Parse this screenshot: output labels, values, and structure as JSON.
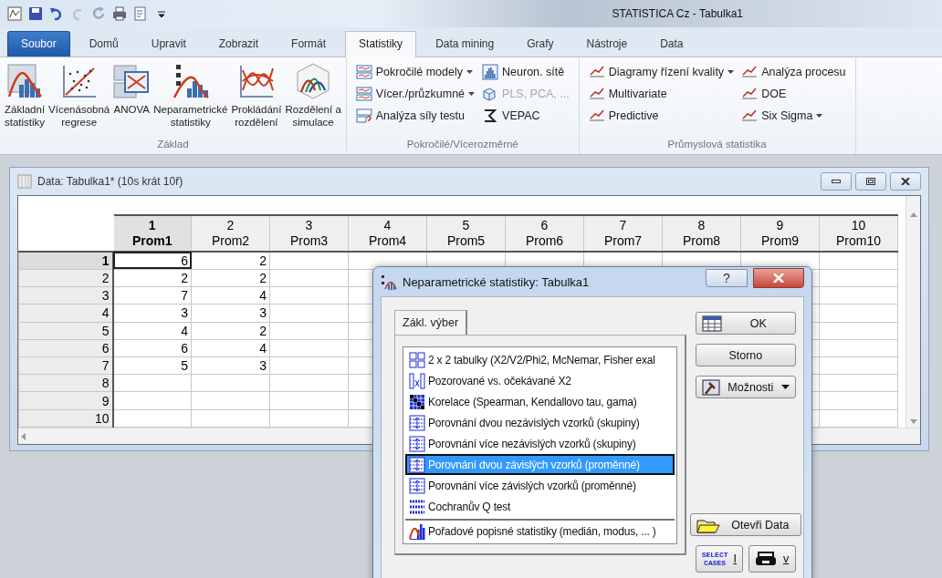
{
  "title_bar": {
    "title": "STATISTICA Cz - Tabulka1"
  },
  "ribbon_tabs": [
    {
      "label": "Soubor",
      "kind": "file",
      "selected": false
    },
    {
      "label": "Domů",
      "kind": "tab",
      "selected": false
    },
    {
      "label": "Upravit",
      "kind": "tab",
      "selected": false
    },
    {
      "label": "Zobrazit",
      "kind": "tab",
      "selected": false
    },
    {
      "label": "Formát",
      "kind": "tab",
      "selected": false
    },
    {
      "label": "Statistiky",
      "kind": "tab",
      "selected": true
    },
    {
      "label": "Data mining",
      "kind": "tab",
      "selected": false
    },
    {
      "label": "Grafy",
      "kind": "tab",
      "selected": false
    },
    {
      "label": "Nástroje",
      "kind": "tab",
      "selected": false
    },
    {
      "label": "Data",
      "kind": "tab",
      "selected": false
    }
  ],
  "ribbon_groups": [
    {
      "label": "Základ",
      "kind": "large",
      "buttons": [
        {
          "label": "Základní\nstatistiky"
        },
        {
          "label": "Vícenásobná\nregrese"
        },
        {
          "label": "ANOVA"
        },
        {
          "label": "Neparametrické\nstatistiky"
        },
        {
          "label": "Prokládání\nrozdělení"
        },
        {
          "label": "Rozdělení a\nsimulace"
        }
      ]
    },
    {
      "label": "Pokročilé/Vícerozměrné",
      "kind": "small",
      "buttons": [
        {
          "label": "Pokročilé modely",
          "dropdown": true,
          "disabled": false
        },
        {
          "label": "Vícer./průzkumné",
          "dropdown": true,
          "disabled": false
        },
        {
          "label": "Analýza síly testu",
          "dropdown": false,
          "disabled": false
        },
        {
          "label": "Neuron. sítě",
          "dropdown": false,
          "disabled": false
        },
        {
          "label": "PLS, PCA, ...",
          "dropdown": false,
          "disabled": true
        },
        {
          "label": "VEPAC",
          "dropdown": false,
          "disabled": false
        }
      ]
    },
    {
      "label": "Průmyslová statistika",
      "kind": "small",
      "buttons": [
        {
          "label": "Diagramy řízení kvality",
          "dropdown": true,
          "disabled": false
        },
        {
          "label": "Multivariate",
          "dropdown": false,
          "disabled": false
        },
        {
          "label": "Predictive",
          "dropdown": false,
          "disabled": false
        },
        {
          "label": "Analýza procesu",
          "dropdown": false,
          "disabled": false
        },
        {
          "label": "DOE",
          "dropdown": false,
          "disabled": false
        },
        {
          "label": "Six Sigma",
          "dropdown": true,
          "disabled": false
        }
      ]
    }
  ],
  "data_window": {
    "title": "Data: Tabulka1* (10s krát 10ř)",
    "columns": [
      {
        "number": "1",
        "name": "Prom1",
        "selected": true
      },
      {
        "number": "2",
        "name": "Prom2",
        "selected": false
      },
      {
        "number": "3",
        "name": "Prom3",
        "selected": false
      },
      {
        "number": "4",
        "name": "Prom4",
        "selected": false
      },
      {
        "number": "5",
        "name": "Prom5",
        "selected": false
      },
      {
        "number": "6",
        "name": "Prom6",
        "selected": false
      },
      {
        "number": "7",
        "name": "Prom7",
        "selected": false
      },
      {
        "number": "8",
        "name": "Prom8",
        "selected": false
      },
      {
        "number": "9",
        "name": "Prom9",
        "selected": false
      },
      {
        "number": "10",
        "name": "Prom10",
        "selected": false
      }
    ],
    "rows": [
      {
        "label": "1",
        "selected": true,
        "cells": [
          "6",
          "2"
        ]
      },
      {
        "label": "2",
        "selected": false,
        "cells": [
          "2",
          "2"
        ]
      },
      {
        "label": "3",
        "selected": false,
        "cells": [
          "7",
          "4"
        ]
      },
      {
        "label": "4",
        "selected": false,
        "cells": [
          "3",
          "3"
        ]
      },
      {
        "label": "5",
        "selected": false,
        "cells": [
          "4",
          "2"
        ]
      },
      {
        "label": "6",
        "selected": false,
        "cells": [
          "6",
          "4"
        ]
      },
      {
        "label": "7",
        "selected": false,
        "cells": [
          "5",
          "3"
        ]
      },
      {
        "label": "8",
        "selected": false
      },
      {
        "label": "9",
        "selected": false
      },
      {
        "label": "10",
        "selected": false
      }
    ]
  },
  "dialog": {
    "title": "Neparametrické statistiky: Tabulka1",
    "help": "?",
    "tabs": [
      {
        "label": "Zákl. výber",
        "selected": true
      }
    ],
    "options": [
      {
        "label": "2 x 2 tabulky (X2/V2/Phi2, McNemar, Fisher exal",
        "selected": false
      },
      {
        "label": "Pozorované vs. očekávané X2",
        "selected": false
      },
      {
        "label": "Korelace (Spearman, Kendallovo tau, gama)",
        "selected": false
      },
      {
        "label": "Porovnání dvou nezávislých vzorků (skupiny)",
        "selected": false
      },
      {
        "label": "Porovnání více nezávislých vzorků (skupiny)",
        "selected": false
      },
      {
        "label": "Porovnání dvou závislých vzorků (proměnné)",
        "selected": true
      },
      {
        "label": "Porovnání více závislých vzorků (proměnné)",
        "selected": false
      },
      {
        "label": "Cochranův Q test",
        "selected": false
      }
    ],
    "footer_option": {
      "label": "Pořadové popisné statistiky (medián, modus, ... )",
      "selected": false
    },
    "buttons": [
      {
        "label": "OK",
        "kind": "ok"
      },
      {
        "label": "Storno",
        "kind": "plain"
      },
      {
        "label": "Možnosti",
        "kind": "menu"
      },
      {
        "label": "Otevři Data",
        "kind": "open"
      },
      {
        "label": "I",
        "icon_text": "SELECT\nCASES",
        "kind": "select_cases"
      },
      {
        "label": "v",
        "kind": "print"
      }
    ]
  }
}
